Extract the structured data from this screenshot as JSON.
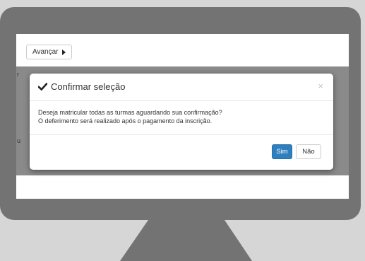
{
  "toolbar": {
    "next_label": "Avançar"
  },
  "background_fragments": {
    "row1": "r",
    "row2": "u"
  },
  "modal": {
    "title": "Confirmar seleção",
    "close_symbol": "×",
    "body_line1": "Deseja matricular todas as turmas aguardando sua confirmação?",
    "body_line2": "O deferimento será realizado após o pagamento da inscrição.",
    "yes_label": "Sim",
    "no_label": "Não"
  },
  "colors": {
    "primary_button": "#2f7fbf",
    "monitor_frame": "#737373",
    "page_background": "#d6d6d6"
  },
  "icons": {
    "title_icon": "checkmark-icon",
    "next_icon": "triangle-right-icon"
  }
}
